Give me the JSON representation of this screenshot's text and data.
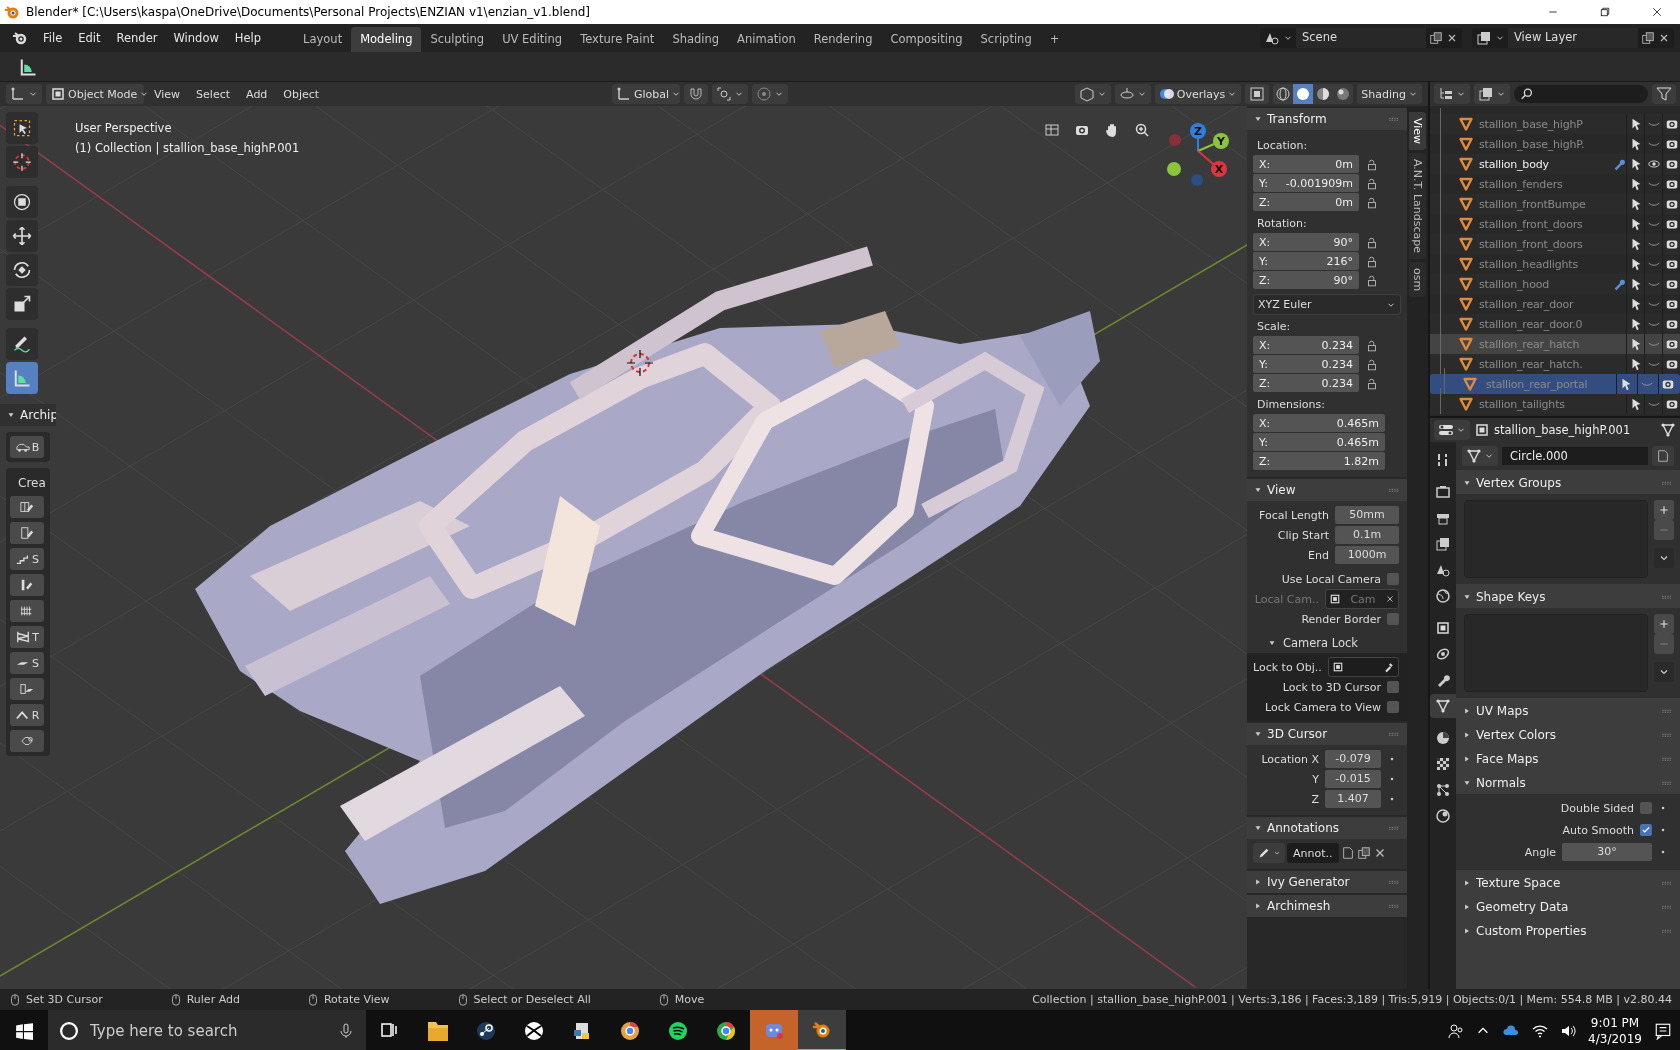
{
  "window": {
    "title": "Blender* [C:\\Users\\kaspa\\OneDrive\\Documents\\Personal Projects\\ENZIAN v1\\enzian_v1.blend]"
  },
  "menu": [
    "File",
    "Edit",
    "Render",
    "Window",
    "Help"
  ],
  "workspaces": [
    {
      "label": "Layout",
      "selected": false
    },
    {
      "label": "Modeling",
      "selected": true
    },
    {
      "label": "Sculpting",
      "selected": false
    },
    {
      "label": "UV Editing",
      "selected": false
    },
    {
      "label": "Texture Paint",
      "selected": false
    },
    {
      "label": "Shading",
      "selected": false
    },
    {
      "label": "Animation",
      "selected": false
    },
    {
      "label": "Rendering",
      "selected": false
    },
    {
      "label": "Compositing",
      "selected": false
    },
    {
      "label": "Scripting",
      "selected": false
    }
  ],
  "add_workspace": "+",
  "scene": "Scene",
  "view_layer": "View Layer",
  "viewport_header": {
    "mode": "Object Mode",
    "menus": [
      "View",
      "Select",
      "Add",
      "Object"
    ],
    "orientation": "Global",
    "overlays": "Overlays",
    "shading": "Shading",
    "shading_modes": [
      {
        "selected": false
      },
      {
        "selected": true
      },
      {
        "selected": false
      },
      {
        "selected": false
      }
    ]
  },
  "viewport": {
    "perspective": "User Perspective",
    "collection": "(1) Collection | stallion_base_highP.001",
    "gizmo": [
      {
        "label": "Z",
        "color": "#2f7fe0"
      },
      {
        "label": "Y",
        "color": "#8bc53a"
      },
      {
        "label": "X",
        "color": "#e0343e"
      }
    ]
  },
  "toolbar": {
    "tools": [
      {
        "kind": "select",
        "selected": false
      },
      {
        "kind": "cursor",
        "selected": false
      },
      {
        "kind": "transform",
        "selected": false
      },
      {
        "kind": "move",
        "selected": false
      },
      {
        "kind": "rotate",
        "selected": false
      },
      {
        "kind": "scale",
        "selected": false
      },
      {
        "kind": "annotate",
        "selected": false
      },
      {
        "kind": "measure",
        "selected": true
      }
    ],
    "panel_title": "Archip",
    "panel_expanded": true,
    "create_label": "Crea",
    "first_tool": "B",
    "create_tools": [
      {
        "kind": "window"
      },
      {
        "kind": "door"
      },
      {
        "kind": "stair",
        "letter": "S"
      },
      {
        "kind": "wall"
      },
      {
        "kind": "fence"
      },
      {
        "kind": "truss",
        "letter": "T"
      },
      {
        "kind": "slab",
        "letter": "S"
      },
      {
        "kind": "floor"
      },
      {
        "kind": "roof",
        "letter": "R"
      },
      {
        "kind": "kitchen"
      }
    ]
  },
  "n_panel": {
    "tabs": [
      {
        "label": "View",
        "selected": true
      },
      {
        "label": "A.N.T. Landscape",
        "selected": false
      },
      {
        "label": "osm",
        "selected": false
      }
    ],
    "transform": {
      "title": "Transform",
      "expanded": true,
      "groups": [
        {
          "kind": "vector",
          "label": "Location:",
          "lockable": true,
          "rows": [
            {
              "axis": "X:",
              "value": "0m"
            },
            {
              "axis": "Y:",
              "value": "-0.001909m"
            },
            {
              "axis": "Z:",
              "value": "0m"
            }
          ]
        },
        {
          "kind": "vector",
          "label": "Rotation:",
          "lockable": true,
          "rows": [
            {
              "axis": "X:",
              "value": "90°"
            },
            {
              "axis": "Y:",
              "value": "216°"
            },
            {
              "axis": "Z:",
              "value": "90°"
            }
          ]
        },
        {
          "kind": "dropdown",
          "value": "XYZ Euler"
        },
        {
          "kind": "vector",
          "label": "Scale:",
          "lockable": true,
          "rows": [
            {
              "axis": "X:",
              "value": "0.234"
            },
            {
              "axis": "Y:",
              "value": "0.234"
            },
            {
              "axis": "Z:",
              "value": "0.234"
            }
          ]
        },
        {
          "kind": "vector",
          "label": "Dimensions:",
          "lockable": false,
          "rows": [
            {
              "axis": "X:",
              "value": "0.465m"
            },
            {
              "axis": "Y:",
              "value": "0.465m"
            },
            {
              "axis": "Z:",
              "value": "1.82m"
            }
          ]
        }
      ]
    },
    "view": {
      "title": "View",
      "expanded": true,
      "fields": [
        {
          "label": "Focal Length",
          "value": "50mm"
        },
        {
          "label": "Clip Start",
          "value": "0.1m"
        },
        {
          "label": "End",
          "value": "1000m"
        }
      ],
      "use_local_camera": {
        "label": "Use Local Camera",
        "checked": false
      },
      "local_camera": {
        "label": "Local Cam..",
        "value": "Cam",
        "disabled": true
      },
      "render_border": {
        "label": "Render Border",
        "checked": false
      },
      "camera_lock": {
        "title": "Camera Lock",
        "expanded": true,
        "lock_object_label": "Lock to Obj..",
        "checks": [
          {
            "label": "Lock to 3D Cursor",
            "checked": false
          },
          {
            "label": "Lock Camera to View",
            "checked": false
          }
        ]
      }
    },
    "cursor": {
      "title": "3D Cursor",
      "expanded": true,
      "rows": [
        {
          "label": "Location X",
          "value": "-0.079"
        },
        {
          "label": "Y",
          "value": "-0.015"
        },
        {
          "label": "Z",
          "value": "1.407"
        }
      ]
    },
    "annotations": {
      "title": "Annotations",
      "expanded": true,
      "layer": "Annot.."
    },
    "collapsed": [
      {
        "title": "Ivy Generator",
        "expanded": false
      },
      {
        "title": "Archimesh",
        "expanded": false
      }
    ]
  },
  "outliner": {
    "items": [
      {
        "name": "stallion_base_highP",
        "active": false,
        "visible": false,
        "modifier": false,
        "selected": false,
        "hover": false
      },
      {
        "name": "stallion_base_highP.",
        "active": false,
        "visible": false,
        "modifier": false,
        "selected": false,
        "hover": false
      },
      {
        "name": "stallion_body",
        "active": true,
        "visible": true,
        "modifier": true,
        "selected": false,
        "hover": false
      },
      {
        "name": "stallion_fenders",
        "active": false,
        "visible": false,
        "modifier": false,
        "selected": false,
        "hover": false
      },
      {
        "name": "stallion_frontBumpe",
        "active": false,
        "visible": false,
        "modifier": false,
        "selected": false,
        "hover": false
      },
      {
        "name": "stallion_front_doors",
        "active": false,
        "visible": false,
        "modifier": false,
        "selected": false,
        "hover": false
      },
      {
        "name": "stallion_front_doors",
        "active": false,
        "visible": false,
        "modifier": false,
        "selected": false,
        "hover": false
      },
      {
        "name": "stallion_headlights",
        "active": false,
        "visible": false,
        "modifier": false,
        "selected": false,
        "hover": false
      },
      {
        "name": "stallion_hood",
        "active": false,
        "visible": false,
        "modifier": true,
        "selected": false,
        "hover": false
      },
      {
        "name": "stallion_rear_door",
        "active": false,
        "visible": false,
        "modifier": false,
        "selected": false,
        "hover": false
      },
      {
        "name": "stallion_rear_door.0",
        "active": false,
        "visible": false,
        "modifier": false,
        "selected": false,
        "hover": false
      },
      {
        "name": "stallion_rear_hatch",
        "active": false,
        "visible": false,
        "modifier": false,
        "selected": false,
        "hover": true
      },
      {
        "name": "stallion_rear_hatch.",
        "active": false,
        "visible": false,
        "modifier": false,
        "selected": false,
        "hover": false
      },
      {
        "name": "stallion_rear_portal",
        "active": false,
        "visible": false,
        "modifier": false,
        "selected": true,
        "hover": false
      },
      {
        "name": "stallion_tailights",
        "active": false,
        "visible": false,
        "modifier": false,
        "selected": false,
        "hover": false
      }
    ]
  },
  "properties": {
    "object": "stallion_base_highP.001",
    "mesh": "Circle.000",
    "tabs": [
      {
        "kind": "tool",
        "selected": false
      },
      {
        "kind": "render",
        "selected": false
      },
      {
        "kind": "output",
        "selected": false
      },
      {
        "kind": "view_layer",
        "selected": false
      },
      {
        "kind": "scene",
        "selected": false
      },
      {
        "kind": "world",
        "selected": false
      },
      {
        "kind": "object",
        "selected": false
      },
      {
        "kind": "constraint",
        "selected": false
      },
      {
        "kind": "modifier",
        "selected": false
      },
      {
        "kind": "mesh",
        "selected": true
      },
      {
        "kind": "material",
        "selected": false
      },
      {
        "kind": "texture",
        "selected": false
      },
      {
        "kind": "particles",
        "selected": false
      },
      {
        "kind": "physics",
        "selected": false
      }
    ],
    "panels": [
      {
        "kind": "list",
        "title": "Vertex Groups",
        "expanded": true
      },
      {
        "kind": "list",
        "title": "Shape Keys",
        "expanded": true
      },
      {
        "kind": "plain",
        "title": "UV Maps",
        "expanded": false
      },
      {
        "kind": "plain",
        "title": "Vertex Colors",
        "expanded": false
      },
      {
        "kind": "plain",
        "title": "Face Maps",
        "expanded": false
      },
      {
        "kind": "normals",
        "title": "Normals",
        "expanded": true,
        "double_sided": {
          "label": "Double Sided",
          "checked": false
        },
        "auto_smooth": {
          "label": "Auto Smooth",
          "checked": true
        },
        "angle": {
          "label": "Angle",
          "value": "30°"
        }
      },
      {
        "kind": "plain",
        "title": "Texture Space",
        "expanded": false
      },
      {
        "kind": "plain",
        "title": "Geometry Data",
        "expanded": false
      },
      {
        "kind": "plain",
        "title": "Custom Properties",
        "expanded": false
      }
    ]
  },
  "status_bar": {
    "hints": [
      "Set 3D Cursor",
      "Ruler Add",
      "Rotate View",
      "Select or Deselect All",
      "Move"
    ],
    "stats": "Collection | stallion_base_highP.001 | Verts:3,186 | Faces:3,189 | Tris:5,919 | Objects:0/1 | Mem: 554.8 MB | v2.80.44"
  },
  "taskbar": {
    "search_placeholder": "Type here to search",
    "apps": [
      {
        "kind": "task_view",
        "flashing": false,
        "active": false
      },
      {
        "kind": "folder",
        "flashing": false,
        "active": false
      },
      {
        "kind": "steam",
        "flashing": false,
        "active": false
      },
      {
        "kind": "xbox",
        "flashing": false,
        "active": false
      },
      {
        "kind": "python",
        "flashing": false,
        "active": false
      },
      {
        "kind": "chrome_canary",
        "flashing": false,
        "active": false
      },
      {
        "kind": "spotify",
        "flashing": false,
        "active": false
      },
      {
        "kind": "chrome",
        "flashing": false,
        "active": false
      },
      {
        "kind": "discord",
        "flashing": true,
        "active": false
      },
      {
        "kind": "blender",
        "flashing": false,
        "active": true
      }
    ],
    "time": "9:01 PM",
    "date": "4/3/2019"
  }
}
